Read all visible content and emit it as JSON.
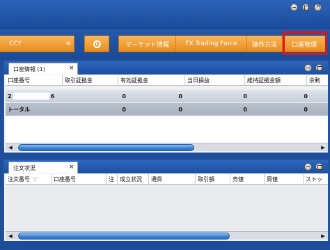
{
  "toolbar": {
    "ccy_label": "CCY",
    "ccy_caret": "≡",
    "menu": {
      "market": "マーケット情報",
      "fx_trading_force": "FX Trading Force",
      "howto": "操作方法",
      "account": "口座管理"
    }
  },
  "account_panel": {
    "tab_label": "口座情報 (1)",
    "tab_close": "×",
    "columns": [
      "口座番号",
      "取引証拠金",
      "有効証拠金",
      "当日損益",
      "維持証拠金額",
      "余剰"
    ],
    "rows": [
      {
        "account_prefix": "2",
        "account_suffix": "6",
        "values": [
          "0",
          "0",
          "0",
          "0"
        ]
      },
      {
        "account_prefix": "トータル",
        "account_suffix": "",
        "values": [
          "0",
          "0",
          "0",
          "0"
        ]
      }
    ]
  },
  "order_panel": {
    "tab_label": "注文状況",
    "tab_close": "×",
    "columns": [
      "注文番号",
      "口座番号",
      "注",
      "成立状況",
      "通貨",
      "取引額",
      "売値",
      "買値",
      "ストッ"
    ]
  },
  "colors": {
    "accent_orange": "#e98b1b",
    "header_blue": "#1f4f9a",
    "highlight_red": "#e0141b"
  }
}
